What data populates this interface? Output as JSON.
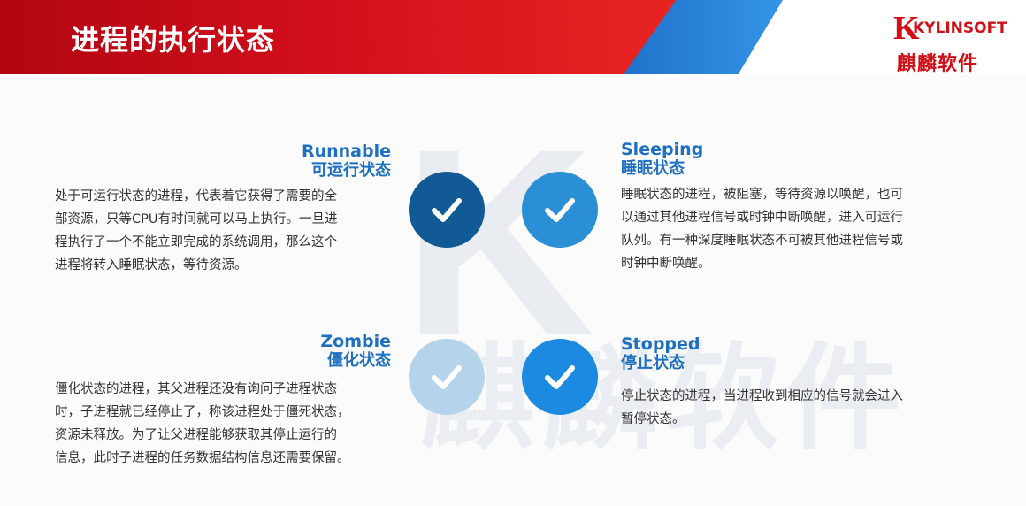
{
  "header": {
    "title": "进程的执行状态",
    "logo_text": "KYLINSOFT",
    "logo_cn": "麒麟软件"
  },
  "watermark": {
    "letter": "K",
    "cn": "麒麟软件"
  },
  "colors": {
    "header_red": "#d4101c",
    "header_blue": "#2f86dd",
    "title_blue": "#1d6fbf",
    "runnable_circle": "#125a96",
    "sleeping_circle": "#2a8fd4",
    "zombie_circle": "#b5d4ec",
    "stopped_circle": "#1c8ae0"
  },
  "states": {
    "runnable": {
      "name_en": "Runnable",
      "name_cn": "可运行状态",
      "lines": [
        "处于可运行状态的进程，代表着它获得了需要的全",
        "部资源，只等CPU有时间就可以马上执行。一旦进",
        "程执行了一个不能立即完成的系统调用，那么这个",
        "进程将转入睡眠状态，等待资源。"
      ],
      "icon": "check-icon"
    },
    "sleeping": {
      "name_en": "Sleeping",
      "name_cn": "睡眠状态",
      "lines": [
        "睡眠状态的进程，被阻塞，等待资源以唤醒，也可",
        "以通过其他进程信号或时钟中断唤醒，进入可运行",
        "队列。有一种深度睡眠状态不可被其他进程信号或",
        "时钟中断唤醒。"
      ],
      "icon": "check-icon"
    },
    "zombie": {
      "name_en": "Zombie",
      "name_cn": "僵化状态",
      "lines": [
        "僵化状态的进程，其父进程还没有询问子进程状态",
        "时，子进程就已经停止了，称该进程处于僵死状态，",
        "资源未释放。为了让父进程能够获取其停止运行的",
        "信息，此时子进程的任务数据结构信息还需要保留。"
      ],
      "icon": "check-icon"
    },
    "stopped": {
      "name_en": "Stopped",
      "name_cn": "停止状态",
      "lines": [
        "停止状态的进程，当进程收到相应的信号就会进入",
        "暂停状态。"
      ],
      "icon": "check-icon"
    }
  }
}
